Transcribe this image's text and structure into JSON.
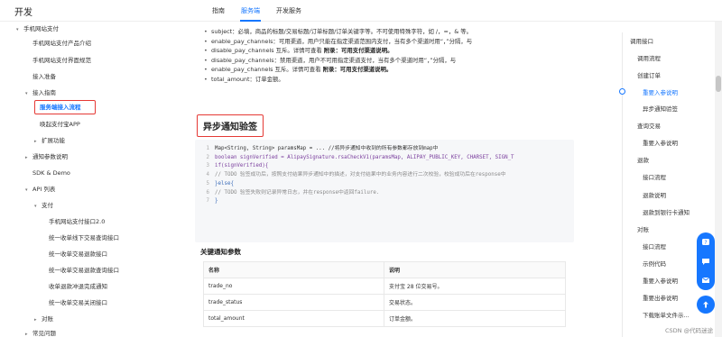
{
  "header": {
    "brand": "开发",
    "tabs": [
      {
        "label": "指南"
      },
      {
        "label": "服务端"
      },
      {
        "label": "开发服务"
      }
    ]
  },
  "sidebar": {
    "items": [
      {
        "label": "手机网站支付",
        "caret": "▾"
      },
      {
        "label": "手机网站支付产品介绍"
      },
      {
        "label": "手机网站支付界面规范"
      },
      {
        "label": "接入准备"
      },
      {
        "label": "接入指南",
        "caret": "▾"
      },
      {
        "label": "服务端接入流程"
      },
      {
        "label": "唤起支付宝APP"
      },
      {
        "label": "扩展功能",
        "caret": "▸"
      },
      {
        "label": "通知参数说明",
        "caret": "▸"
      },
      {
        "label": "SDK & Demo"
      },
      {
        "label": "API 列表",
        "caret": "▾"
      },
      {
        "label": "支付",
        "caret": "▾"
      },
      {
        "label": "手机网站支付接口2.0"
      },
      {
        "label": "统一收单线下交易查询接口"
      },
      {
        "label": "统一收单交易退款接口"
      },
      {
        "label": "统一收单交易退款查询接口"
      },
      {
        "label": "收单退款冲退完成通知"
      },
      {
        "label": "统一收单交易关闭接口"
      },
      {
        "label": "对账",
        "caret": "▸"
      },
      {
        "label": "常见问题",
        "caret": "▸"
      }
    ]
  },
  "content": {
    "bullets": [
      {
        "text": "subject：必填，商品的标题/交易标题/订单标题/订单关键字等。不可使用特殊字符，如 /，=，& 等。",
        "bold": ""
      },
      {
        "text": "enable_pay_channels：可用渠道，用户只能在指定渠道范围内支付，当有多个渠道时用“，”分隔，与",
        "bold": ""
      },
      {
        "text": "disable_pay_channels 互斥。详情可查看 ",
        "bold": "附录：可用支付渠道说明。"
      },
      {
        "text": "disable_pay_channels：禁用渠道，用户不可用指定渠道支付，当有多个渠道时用“，”分隔，与",
        "bold": ""
      },
      {
        "text": "enable_pay_channels 互斥。详情可查看 ",
        "bold": "附录：可用支付渠道说明。"
      },
      {
        "text": "total_amount：订单金额。",
        "bold": ""
      }
    ],
    "section_title": "异步通知验签",
    "code_lines": [
      {
        "n": "1",
        "text": "Map<String, String> paramsMap = ... //将异步通知中收到的所有参数都存放到map中"
      },
      {
        "n": "2",
        "text": "boolean signVerified = AlipaySignature.rsaCheckV1(paramsMap, ALIPAY_PUBLIC_KEY, CHARSET, SIGN_T"
      },
      {
        "n": "3",
        "text": "if(signVerified){"
      },
      {
        "n": "4",
        "text": "// TODO 验签成功后，按照支付结果异步通知中的描述，对支付结果中的业务内容进行二次校验，校验成功后在response中"
      },
      {
        "n": "5",
        "text": "}else{"
      },
      {
        "n": "6",
        "text": "// TODO 验签失败则记录异常日志，并在response中返回failure."
      },
      {
        "n": "7",
        "text": "}"
      }
    ],
    "params_title": "关键通知参数",
    "table": {
      "headers": [
        "名称",
        "说明"
      ],
      "rows": [
        [
          "trade_no",
          "支付宝 28 位交易号。"
        ],
        [
          "trade_status",
          "交易状态。"
        ],
        [
          "total_amount",
          "订单金额。"
        ]
      ]
    }
  },
  "toc": {
    "items": [
      {
        "label": "调用接口"
      },
      {
        "label": "调用流程"
      },
      {
        "label": "创建订单"
      },
      {
        "label": "重要入参说明"
      },
      {
        "label": "异步通知验签"
      },
      {
        "label": "查询交易"
      },
      {
        "label": "重要入参说明"
      },
      {
        "label": "退款"
      },
      {
        "label": "接口流程"
      },
      {
        "label": "退款说明"
      },
      {
        "label": "退款到银行卡通知"
      },
      {
        "label": "对账"
      },
      {
        "label": "接口流程"
      },
      {
        "label": "示例代码"
      },
      {
        "label": "重要入参说明"
      },
      {
        "label": "重要出参说明"
      },
      {
        "label": "下载账单文件示..."
      }
    ]
  },
  "watermark": "CSDN @代码迷途",
  "colors": {
    "accent": "#1677ff",
    "highlight": "#e53935"
  }
}
